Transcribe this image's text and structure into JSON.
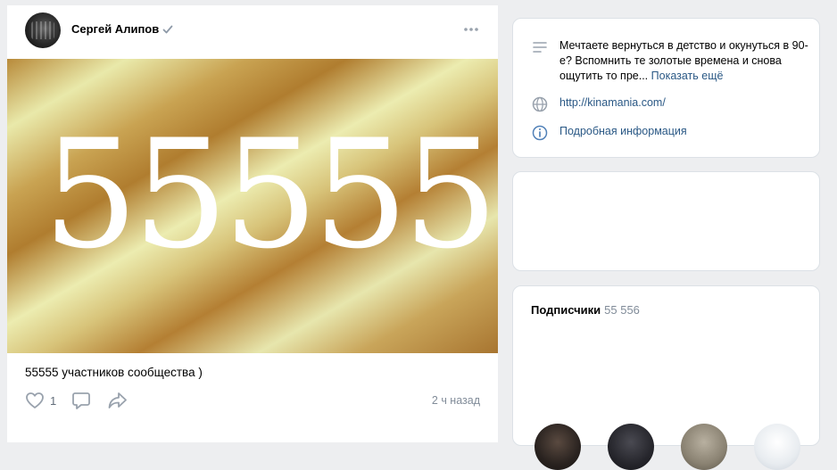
{
  "post": {
    "author": "Сергей Алипов",
    "banner_text": "55555",
    "text": "55555 участников сообщества )",
    "likes": "1",
    "time": "2 ч назад",
    "icons": {
      "verified": "verified-check-icon",
      "more": "more-dots-icon",
      "like": "heart-icon",
      "comment": "comment-icon",
      "share": "share-icon"
    }
  },
  "info": {
    "description": "Мечтаете вернуться в детство и окунуться в 90-е? Вспомнить те золотые времена и снова ощутить то пре...",
    "show_more": "Показать ещё",
    "website": "http://kinamania.com/",
    "details": "Подробная информация"
  },
  "subscribers": {
    "title": "Подписчики",
    "count": "55 556"
  },
  "colors": {
    "link": "#2a5885",
    "background": "#edeef0",
    "muted": "#818c99"
  }
}
